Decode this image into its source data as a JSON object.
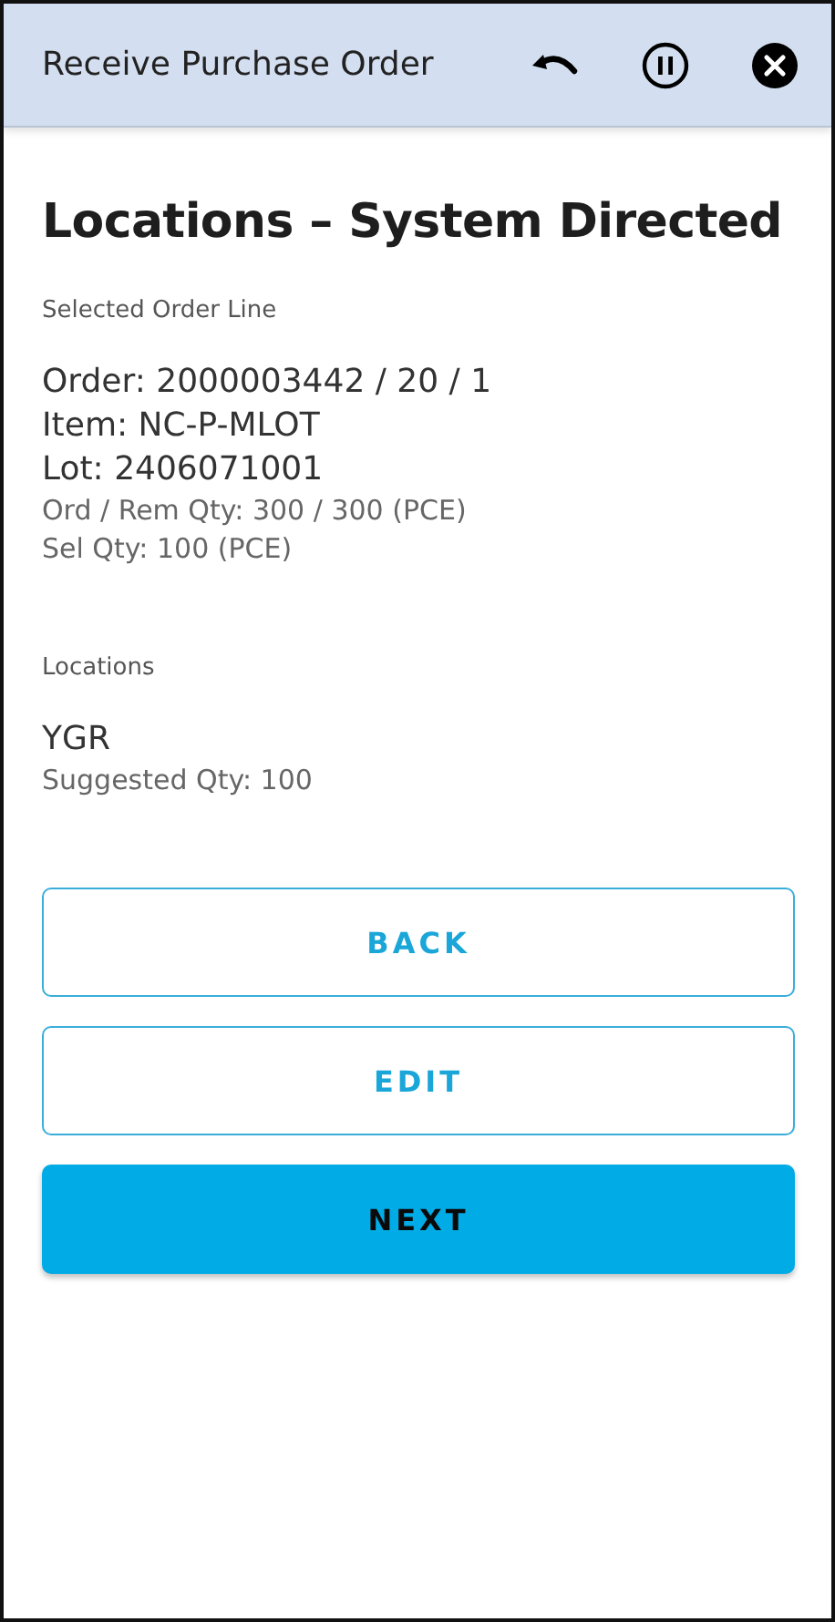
{
  "header": {
    "title": "Receive Purchase Order",
    "actions": [
      {
        "kind": "undo"
      },
      {
        "kind": "pause"
      },
      {
        "kind": "close"
      }
    ]
  },
  "heading": "Locations – System Directed",
  "order_line": {
    "label": "Selected Order Line",
    "lines": [
      "Order: 2000003442 / 20 / 1",
      "Item: NC-P-MLOT",
      "Lot: 2406071001"
    ],
    "details": [
      "Ord / Rem Qty: 300 / 300 (PCE)",
      "Sel Qty: 100 (PCE)"
    ]
  },
  "locations": {
    "label": "Locations",
    "items": [
      {
        "name": "YGR",
        "detail": "Suggested Qty: 100"
      }
    ]
  },
  "buttons": [
    {
      "label": "BACK",
      "kind": "outlined"
    },
    {
      "label": "EDIT",
      "kind": "outlined"
    },
    {
      "label": "NEXT",
      "kind": "filled"
    }
  ]
}
